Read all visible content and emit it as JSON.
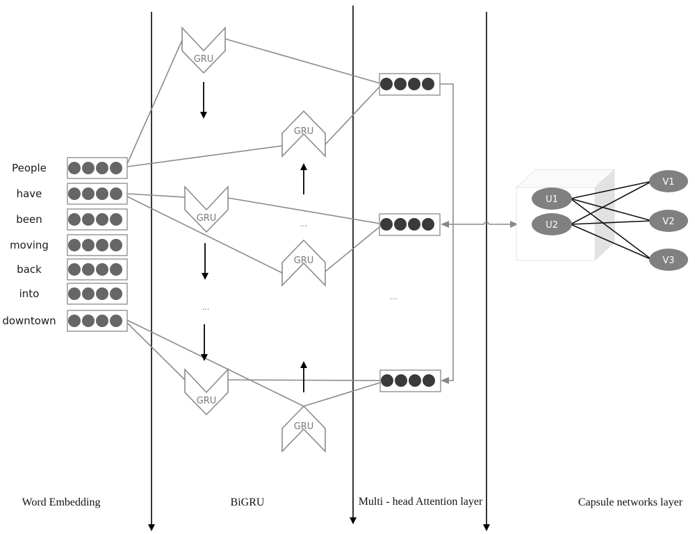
{
  "words": [
    "People",
    "have",
    "been",
    "moving",
    "back",
    "into",
    "downtown"
  ],
  "gru_label": "GRU",
  "ellipsis": "...",
  "layers": {
    "word_embedding": "Word Embedding",
    "bigru": "BiGRU",
    "attention": "Multi - head Attention layer",
    "capsule": "Capsule networks layer"
  },
  "capsules": {
    "inputs": [
      "U1",
      "U2"
    ],
    "outputs": [
      "V1",
      "V2",
      "V3"
    ]
  },
  "colors": {
    "line": "#8a8a8a",
    "dot_embedding": "#666666",
    "dot_attention": "#3a3a3a",
    "capsule": "#808080",
    "divider": "#000000"
  }
}
